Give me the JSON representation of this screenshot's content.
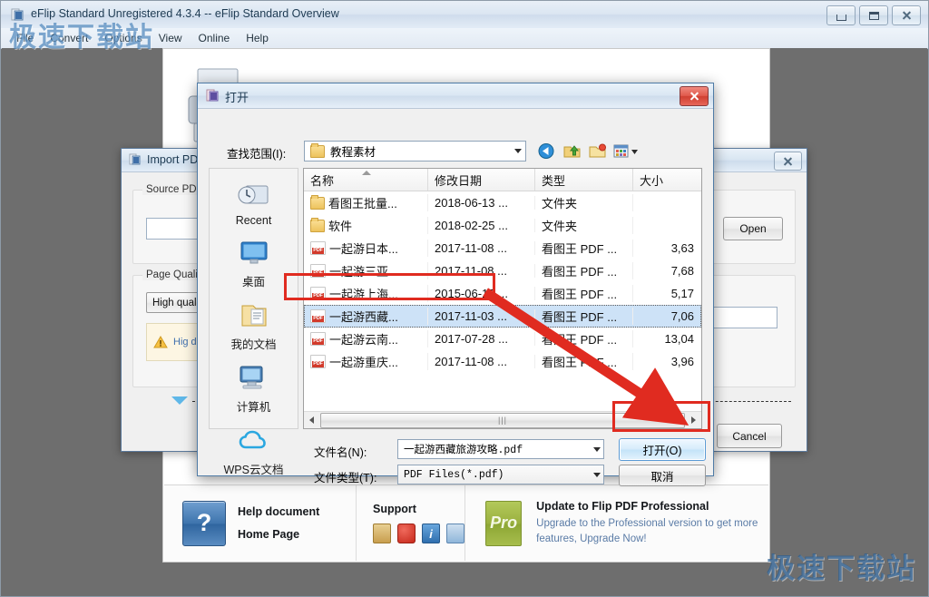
{
  "app": {
    "title": "eFlip Standard Unregistered 4.3.4  -- eFlip Standard Overview",
    "menu": [
      "File",
      "Convert",
      "Options",
      "View",
      "Online",
      "Help"
    ],
    "window_buttons": {
      "minimize": "minimize-button",
      "maximize": "maximize-button",
      "close": "close-button"
    }
  },
  "watermark": {
    "top": "极速下载站",
    "bottom": "极速下载站"
  },
  "help_bar": {
    "help_document": "Help document",
    "home_page": "Home Page",
    "support_title": "Support",
    "question_mark": "?",
    "pro_badge": "Pro",
    "pro_title": "Update to Flip PDF Professional",
    "pro_desc": "Upgrade to the Professional version to get more features, Upgrade Now!",
    "support_icons": [
      "manual-icon",
      "pdf-icon",
      "info-icon",
      "download-icon"
    ]
  },
  "import_window": {
    "title": "Import PDF",
    "source_group": "Source PDF",
    "source_value": "",
    "open_button": "Open",
    "page_quality_group": "Page Quality",
    "page_quality_value": "High quali",
    "warning_text": "Hig\ndisk",
    "expander": "----------",
    "cancel_button": "Cancel",
    "close_button": "close-button"
  },
  "open_dialog": {
    "title": "打开",
    "close_button": "close-button",
    "lookin_label": "查找范围(I):",
    "lookin_value": "教程素材",
    "toolbar_icons": [
      "back-icon",
      "up-folder-icon",
      "new-folder-icon",
      "view-mode-icon"
    ],
    "places": [
      {
        "label": "Recent",
        "icon": "recent-icon"
      },
      {
        "label": "桌面",
        "icon": "desktop-icon"
      },
      {
        "label": "我的文档",
        "icon": "my-documents-icon"
      },
      {
        "label": "计算机",
        "icon": "computer-icon"
      },
      {
        "label": "WPS云文档",
        "icon": "wps-cloud-icon"
      }
    ],
    "columns": [
      "名称",
      "修改日期",
      "类型",
      "大小"
    ],
    "rows": [
      {
        "name": "看图王批量...",
        "date": "2018-06-13 ...",
        "type": "文件夹",
        "size": "",
        "icon": "folder-icon",
        "selected": false
      },
      {
        "name": "软件",
        "date": "2018-02-25 ...",
        "type": "文件夹",
        "size": "",
        "icon": "folder-icon",
        "selected": false
      },
      {
        "name": "一起游日本...",
        "date": "2017-11-08 ...",
        "type": "看图王 PDF ...",
        "size": "3,63",
        "icon": "pdf-icon",
        "selected": false
      },
      {
        "name": "一起游三亚...",
        "date": "2017-11-08 ...",
        "type": "看图王 PDF ...",
        "size": "7,68",
        "icon": "pdf-icon",
        "selected": false
      },
      {
        "name": "一起游上海...",
        "date": "2015-06-15 ...",
        "type": "看图王 PDF ...",
        "size": "5,17",
        "icon": "pdf-icon",
        "selected": false
      },
      {
        "name": "一起游西藏...",
        "date": "2017-11-03 ...",
        "type": "看图王 PDF ...",
        "size": "7,06",
        "icon": "pdf-icon",
        "selected": true
      },
      {
        "name": "一起游云南...",
        "date": "2017-07-28 ...",
        "type": "看图王 PDF ...",
        "size": "13,04",
        "icon": "pdf-icon",
        "selected": false
      },
      {
        "name": "一起游重庆...",
        "date": "2017-11-08 ...",
        "type": "看图王 PDF ...",
        "size": "3,96",
        "icon": "pdf-icon",
        "selected": false
      }
    ],
    "filename_label": "文件名(N):",
    "filename_value": "一起游西藏旅游攻略.pdf",
    "filetype_label": "文件类型(T):",
    "filetype_value": "PDF Files(*.pdf)",
    "open_button": "打开(O)",
    "cancel_button": "取消",
    "scrollbar_grip": "|||"
  },
  "annotations": {
    "accent_color": "#e02b20",
    "highlight_row": "一起游西藏...",
    "highlight_button": "打开(O)"
  }
}
